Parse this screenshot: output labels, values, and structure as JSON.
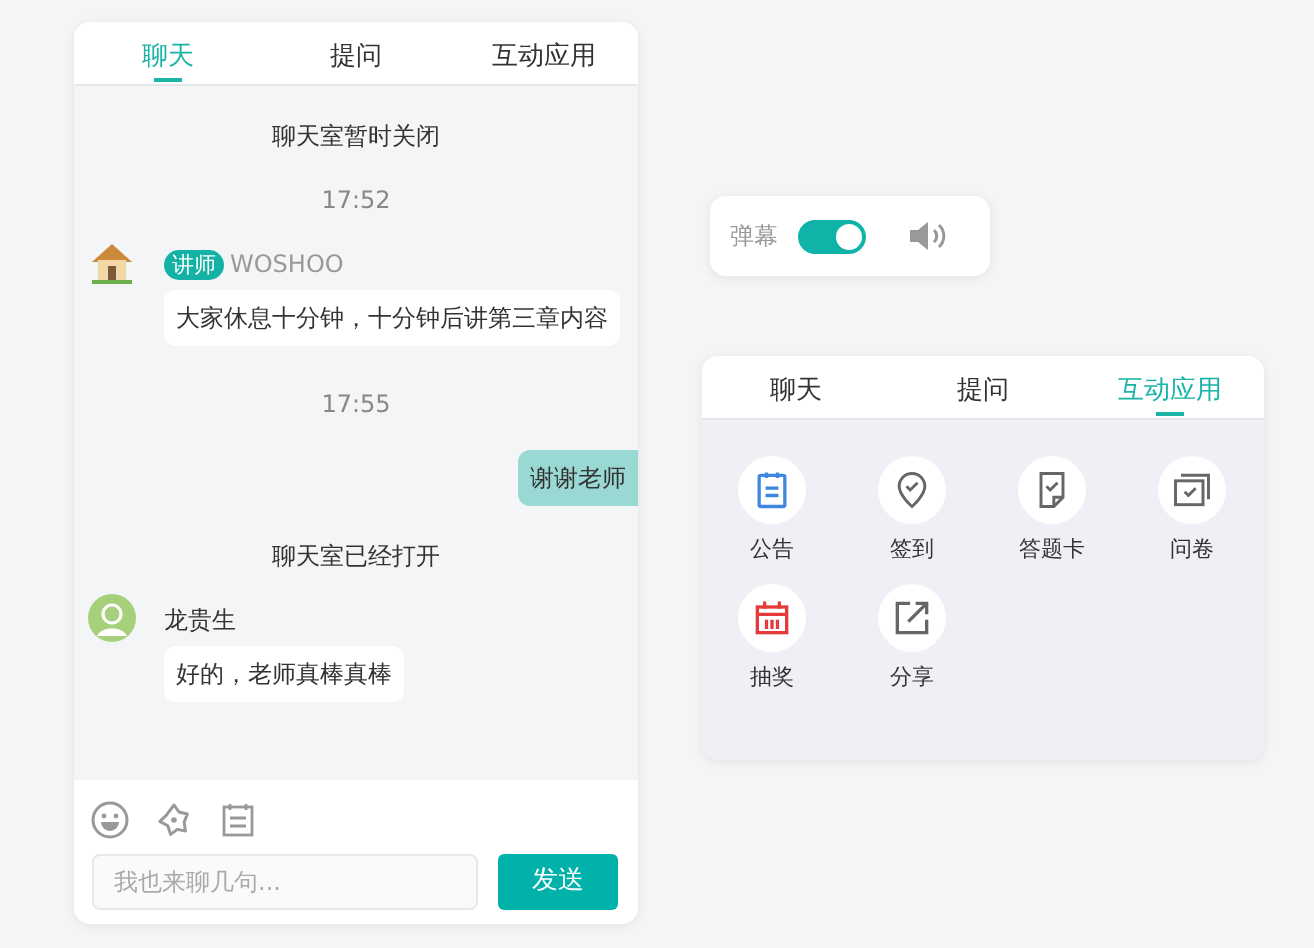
{
  "chat_panel": {
    "tabs": [
      {
        "label": "聊天",
        "selected": true
      },
      {
        "label": "提问",
        "selected": false
      },
      {
        "label": "互动应用",
        "selected": false
      }
    ],
    "messages": [
      {
        "kind": "system",
        "text": "聊天室暂时关闭"
      },
      {
        "kind": "time",
        "text": "17:52"
      },
      {
        "kind": "incoming",
        "avatar": {
          "kind": "house"
        },
        "badge": "讲师",
        "sender": "WOSHOO",
        "text": "大家休息十分钟，十分钟后讲第三章内容"
      },
      {
        "kind": "time",
        "text": "17:55"
      },
      {
        "kind": "outgoing",
        "text": "谢谢老师"
      },
      {
        "kind": "system",
        "text": "聊天室已经打开"
      },
      {
        "kind": "incoming",
        "avatar": {
          "kind": "person"
        },
        "sender": "龙贵生",
        "text": "好的，老师真棒真棒"
      }
    ],
    "input": {
      "placeholder": "我也来聊几句..."
    },
    "send_button": "发送"
  },
  "danmaku_bar": {
    "label": "弹幕",
    "on": true
  },
  "app_panel": {
    "tabs": [
      {
        "label": "聊天",
        "selected": false
      },
      {
        "label": "提问",
        "selected": false
      },
      {
        "label": "互动应用",
        "selected": true
      }
    ],
    "apps": [
      {
        "kind": "notice",
        "label": "公告"
      },
      {
        "kind": "checkin",
        "label": "签到"
      },
      {
        "kind": "answer",
        "label": "答题卡"
      },
      {
        "kind": "survey",
        "label": "问卷"
      },
      {
        "kind": "lottery",
        "label": "抽奖"
      },
      {
        "kind": "share",
        "label": "分享"
      }
    ]
  }
}
